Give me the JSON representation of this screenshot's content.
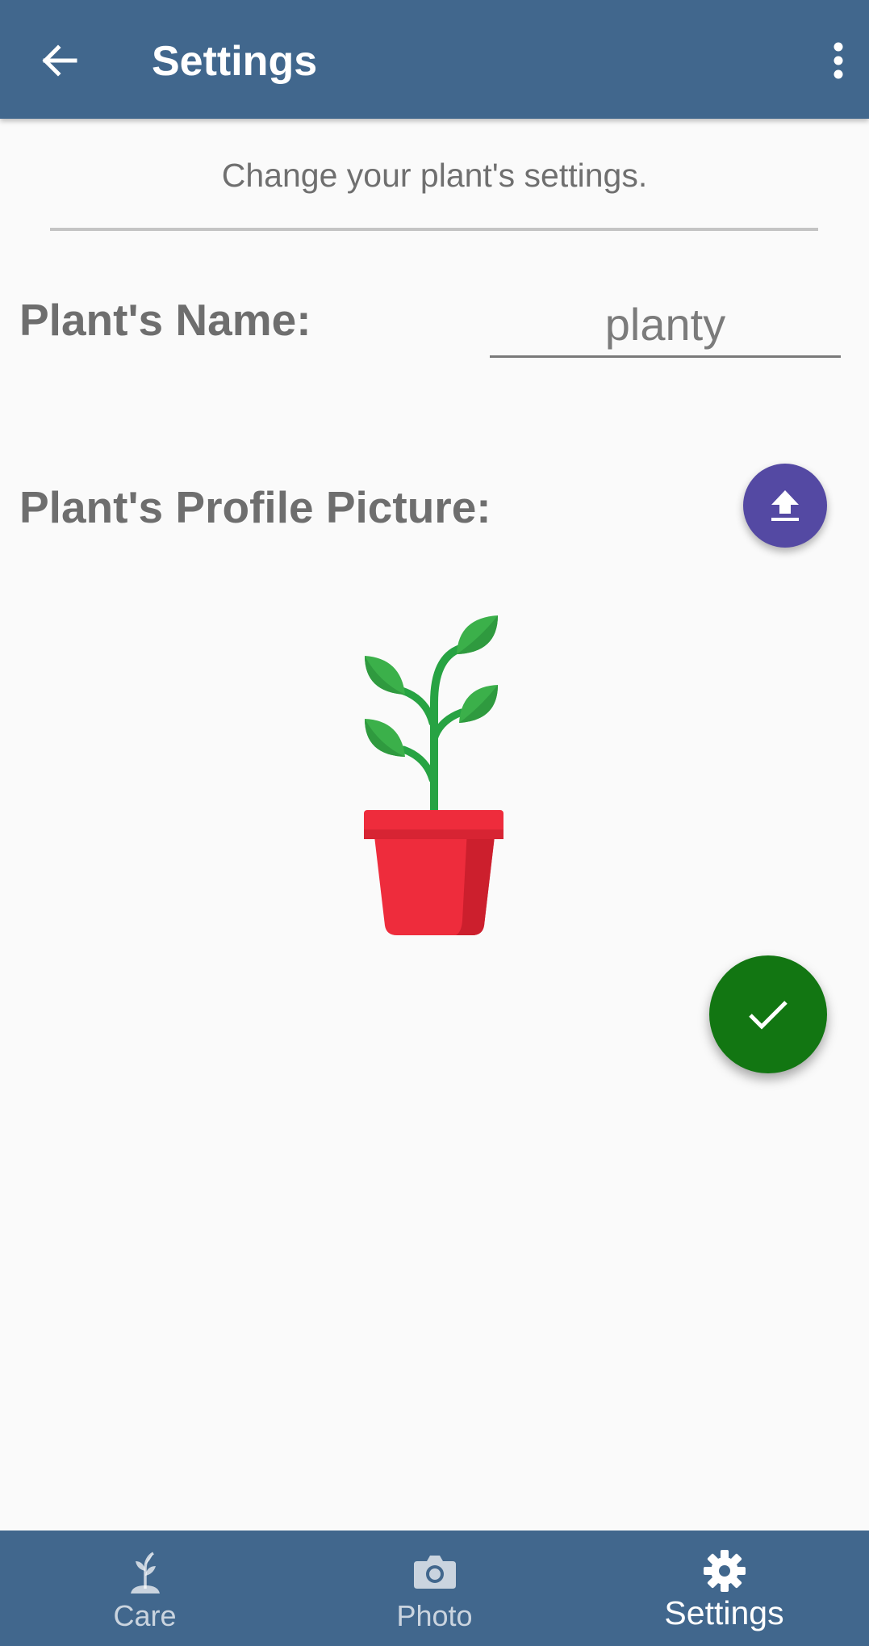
{
  "appbar": {
    "title": "Settings",
    "back_icon": "arrow-left-icon",
    "menu_icon": "more-vertical-icon"
  },
  "subtitle": "Change your plant's settings.",
  "name_section": {
    "label": "Plant's Name:",
    "value": "planty"
  },
  "picture_section": {
    "label": "Plant's Profile Picture:",
    "upload_icon": "upload-icon"
  },
  "confirm_icon": "check-icon",
  "bottom_nav": {
    "items": [
      {
        "label": "Care",
        "icon": "sprout-icon",
        "active": false
      },
      {
        "label": "Photo",
        "icon": "camera-icon",
        "active": false
      },
      {
        "label": "Settings",
        "icon": "gear-icon",
        "active": true
      }
    ]
  },
  "colors": {
    "primary": "#41678d",
    "upload_fab": "#5449a3",
    "confirm_fab": "#127612",
    "pot": "#ee2c3c",
    "leaf": "#3bb04a"
  }
}
